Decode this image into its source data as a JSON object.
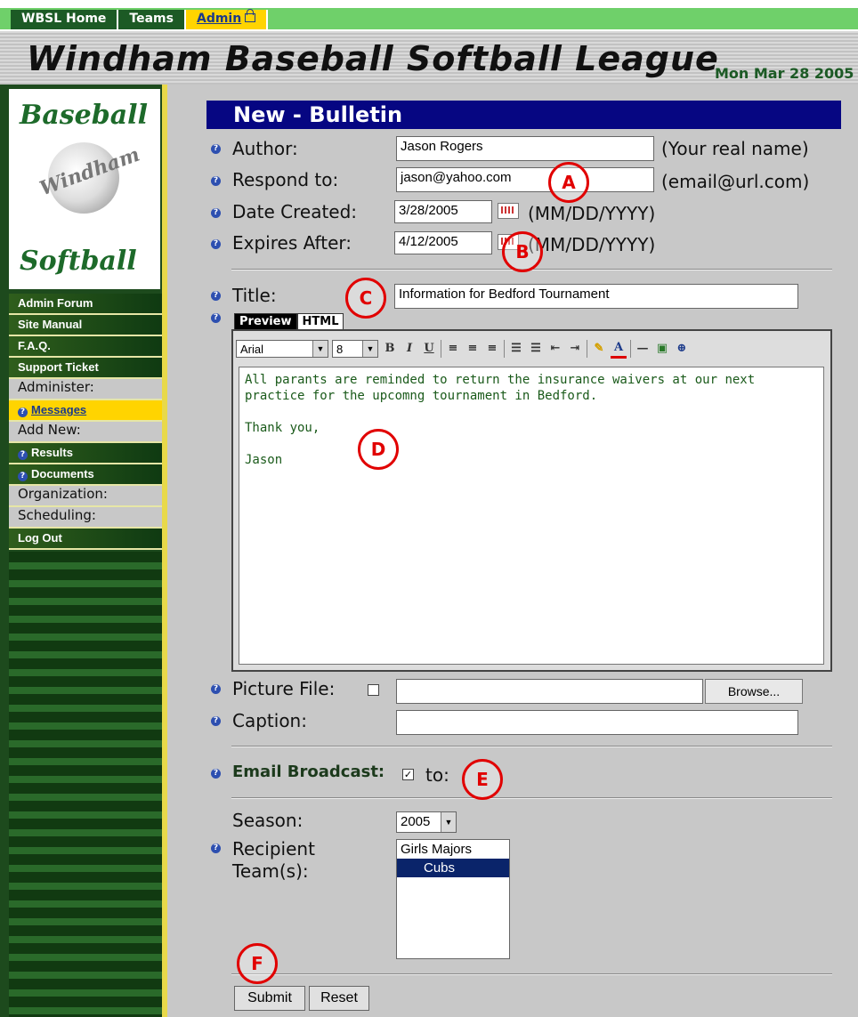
{
  "top_nav": {
    "home": "WBSL Home",
    "teams": "Teams",
    "admin": "Admin"
  },
  "header": {
    "title": "Windham Baseball Softball League",
    "date": "Mon Mar 28 2005"
  },
  "logo": {
    "top": "Baseball",
    "middle": "Windham",
    "bottom": "Softball"
  },
  "sidebar": {
    "admin_forum": "Admin Forum",
    "site_manual": "Site Manual",
    "faq": "F.A.Q.",
    "support_ticket": "Support Ticket",
    "administer": "Administer:",
    "messages": "Messages",
    "add_new": "Add New:",
    "results": "Results",
    "documents": "Documents",
    "organization": "Organization:",
    "scheduling": "Scheduling:",
    "log_out": "Log Out"
  },
  "form": {
    "heading": "New - Bulletin",
    "author_label": "Author:",
    "author_value": "Jason Rogers",
    "author_hint": "(Your real name)",
    "respond_label": "Respond to:",
    "respond_value": "jason@yahoo.com",
    "respond_hint": "(email@url.com)",
    "date_created_label": "Date Created:",
    "date_created_value": "3/28/2005",
    "date_created_hint": "(MM/DD/YYYY)",
    "expires_label": "Expires After:",
    "expires_value": "4/12/2005",
    "expires_hint": "(MM/DD/YYYY)",
    "title_label": "Title:",
    "title_value": "Information for Bedford Tournament",
    "tab_preview": "Preview",
    "tab_html": "HTML",
    "font_name": "Arial",
    "font_size": "8",
    "body_text": "All parants are reminded to return the insurance waivers at our next\npractice for the upcomng tournament in Bedford.\n\nThank you,\n\nJason",
    "picture_label": "Picture File:",
    "browse_label": "Browse...",
    "caption_label": "Caption:",
    "email_label": "Email Broadcast:",
    "email_to": "to:",
    "season_label": "Season:",
    "season_value": "2005",
    "recipient_label_1": "Recipient",
    "recipient_label_2": "Team(s):",
    "teams": [
      "Girls Majors",
      "Cubs"
    ],
    "submit_label": "Submit",
    "reset_label": "Reset"
  },
  "annotations": {
    "a": "A",
    "b": "B",
    "c": "C",
    "d": "D",
    "e": "E",
    "f": "F"
  },
  "colors": {
    "accent": "#060682",
    "brand_green": "#1c5a25",
    "annotation_red": "#e10000"
  }
}
